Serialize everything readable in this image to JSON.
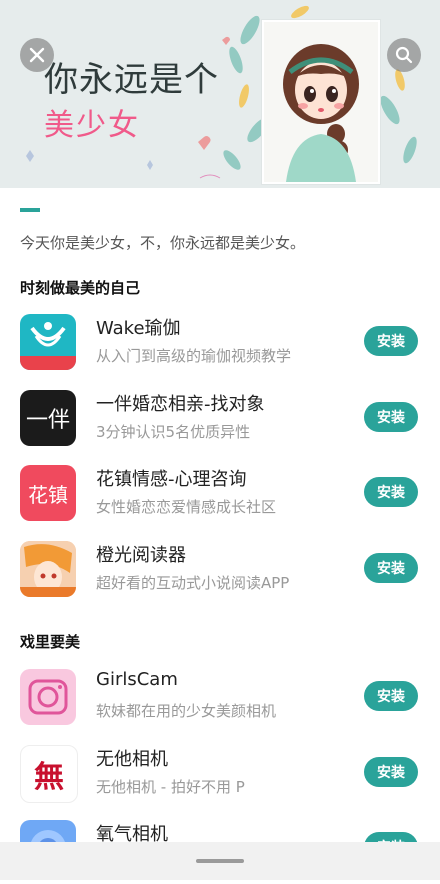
{
  "banner": {
    "title_line1": "你永远是个",
    "title_line2": "美少女"
  },
  "description": "今天你是美少女，不，你永远都是美少女。",
  "section1": {
    "title": "时刻做最美的自己",
    "apps": [
      {
        "name": "Wake瑜伽",
        "subtitle": "从入门到高级的瑜伽视频教学",
        "install": "安装"
      },
      {
        "name": "一伴婚恋相亲-找对象",
        "subtitle": "3分钟认识5名优质异性",
        "install": "安装",
        "icon_text": "一伴"
      },
      {
        "name": "花镇情感-心理咨询",
        "subtitle": "女性婚恋恋爱情感成长社区",
        "install": "安装",
        "icon_text": "花镇"
      },
      {
        "name": "橙光阅读器",
        "subtitle": "超好看的互动式小说阅读APP",
        "install": "安装"
      }
    ]
  },
  "section2": {
    "title": "戏里要美",
    "apps": [
      {
        "name": "GirlsCam",
        "subtitle": "软妹都在用的少女美颜相机",
        "install": "安装"
      },
      {
        "name": "无他相机",
        "subtitle": "无他相机 - 拍好不用 P",
        "install": "安装",
        "icon_text": "無"
      },
      {
        "name": "氧气相机",
        "subtitle": "",
        "install": "安装"
      }
    ]
  },
  "colors": {
    "accent": "#2aa39a",
    "pink": "#f05a8a"
  }
}
